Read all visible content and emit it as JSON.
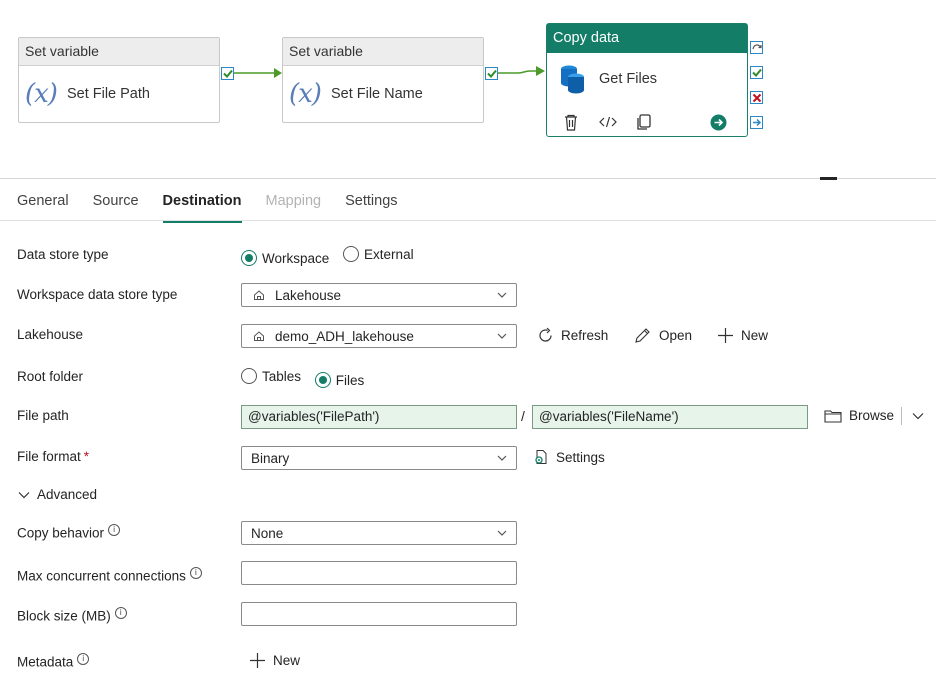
{
  "pipeline": {
    "activities": [
      {
        "type_label": "Set variable",
        "name": "Set File Path",
        "icon": "variable-icon"
      },
      {
        "type_label": "Set variable",
        "name": "Set File Name",
        "icon": "variable-icon"
      }
    ],
    "copy_activity": {
      "type_label": "Copy data",
      "name": "Get Files",
      "icon": "database-icon"
    }
  },
  "tabs": [
    {
      "label": "General"
    },
    {
      "label": "Source"
    },
    {
      "label": "Destination",
      "active": true
    },
    {
      "label": "Mapping",
      "disabled": true
    },
    {
      "label": "Settings"
    }
  ],
  "form": {
    "data_store_type": {
      "label": "Data store type",
      "options": [
        "Workspace",
        "External"
      ],
      "selected": "Workspace"
    },
    "workspace_data_store_type": {
      "label": "Workspace data store type",
      "value": "Lakehouse"
    },
    "lakehouse": {
      "label": "Lakehouse",
      "value": "demo_ADH_lakehouse",
      "refresh": "Refresh",
      "open": "Open",
      "new": "New"
    },
    "root_folder": {
      "label": "Root folder",
      "options": [
        "Tables",
        "Files"
      ],
      "selected": "Files"
    },
    "file_path": {
      "label": "File path",
      "folder": "@variables('FilePath')",
      "separator": "/",
      "file": "@variables('FileName')",
      "browse": "Browse"
    },
    "file_format": {
      "label": "File format",
      "required_mark": "*",
      "value": "Binary",
      "settings": "Settings"
    },
    "advanced": {
      "label": "Advanced"
    },
    "copy_behavior": {
      "label": "Copy behavior",
      "value": "None"
    },
    "max_concurrent": {
      "label": "Max concurrent connections",
      "value": ""
    },
    "block_size": {
      "label": "Block size (MB)",
      "value": ""
    },
    "metadata": {
      "label": "Metadata",
      "new": "New"
    }
  },
  "colors": {
    "accent": "#137d68",
    "dynamic_bg": "#e6f4ea",
    "link_arrow": "#4c9a2a"
  }
}
